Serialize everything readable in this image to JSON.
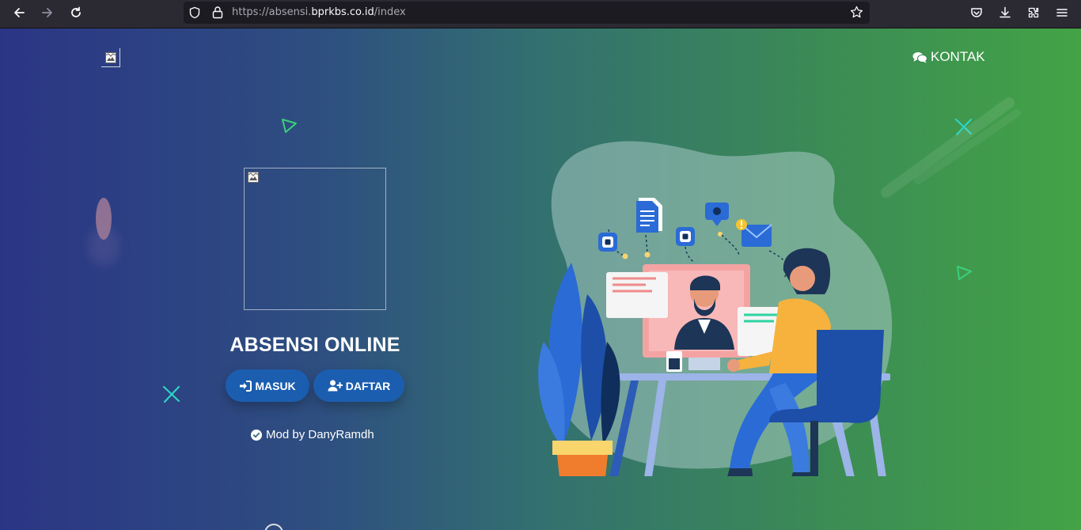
{
  "browser": {
    "url_prefix": "https://absensi.",
    "url_host": "bprkbs.co.id",
    "url_path": "/index",
    "icons": [
      "back-arrow-icon",
      "forward-arrow-icon",
      "reload-icon",
      "shield-icon",
      "lock-icon",
      "bookmark-star-icon",
      "pocket-icon",
      "download-icon",
      "extensions-icon",
      "menu-icon"
    ]
  },
  "header": {
    "kontak_label": "KONTAK",
    "kontak_icon": "comments-icon"
  },
  "main": {
    "title": "ABSENSI ONLINE",
    "buttons": [
      {
        "label": "MASUK",
        "icon": "sign-in-icon"
      },
      {
        "label": "DAFTAR",
        "icon": "user-plus-icon"
      }
    ],
    "credit": "Mod by DanyRamdh",
    "credit_icon": "check-circle-icon"
  },
  "colors": {
    "gradient_left": "#2b3585",
    "gradient_right": "#43a346",
    "button_bg": "#1b5eb0",
    "accent_cyan": "#2ed3c3",
    "accent_green": "#39d07a"
  }
}
